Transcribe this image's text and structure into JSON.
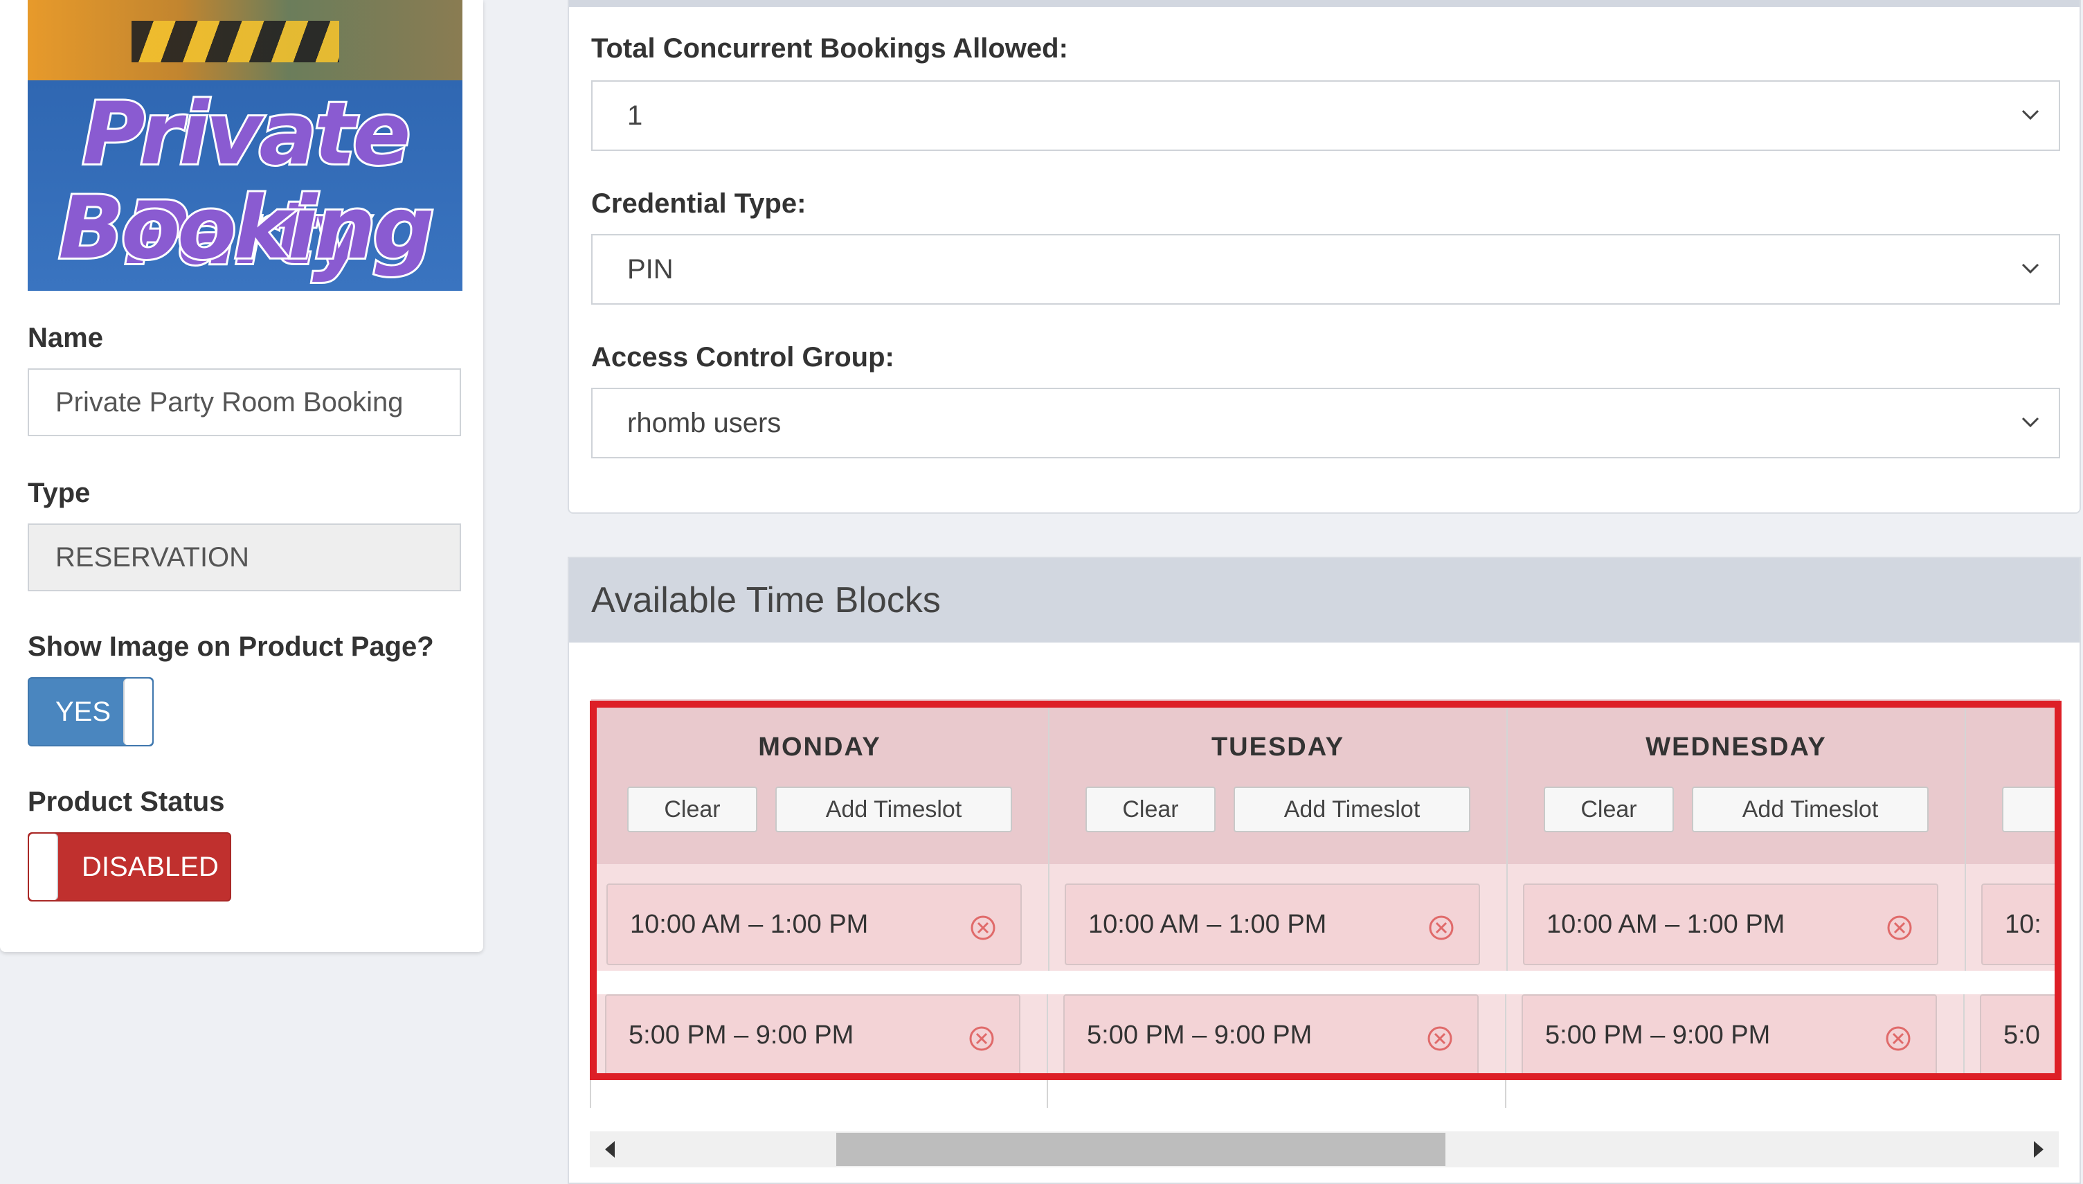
{
  "left": {
    "banner": {
      "line1": "Private Party",
      "line2": "Booking"
    },
    "name_label": "Name",
    "name_value": "Private Party Room Booking",
    "type_label": "Type",
    "type_value": "RESERVATION",
    "show_image_label": "Show Image on Product Page?",
    "show_image_toggle": "YES",
    "status_label": "Product Status",
    "status_toggle": "DISABLED"
  },
  "settings": {
    "concurrent_label": "Total Concurrent Bookings Allowed:",
    "concurrent_value": "1",
    "credential_label": "Credential Type:",
    "credential_value": "PIN",
    "access_label": "Access Control Group:",
    "access_value": "rhomb users"
  },
  "time_blocks": {
    "title": "Available Time Blocks",
    "clear_label": "Clear",
    "add_label": "Add Timeslot",
    "days": [
      {
        "name": "MONDAY",
        "slots": [
          "10:00 AM – 1:00 PM",
          "5:00 PM – 9:00 PM"
        ]
      },
      {
        "name": "TUESDAY",
        "slots": [
          "10:00 AM – 1:00 PM",
          "5:00 PM – 9:00 PM"
        ]
      },
      {
        "name": "WEDNESDAY",
        "slots": [
          "10:00 AM – 1:00 PM",
          "5:00 PM – 9:00 PM"
        ]
      },
      {
        "name": "",
        "slots": [
          "10:",
          "5:0"
        ]
      }
    ]
  },
  "colors": {
    "accent_blue": "#4a86bf",
    "disabled_red": "#c0302e",
    "highlight_frame": "#dd1f26"
  }
}
